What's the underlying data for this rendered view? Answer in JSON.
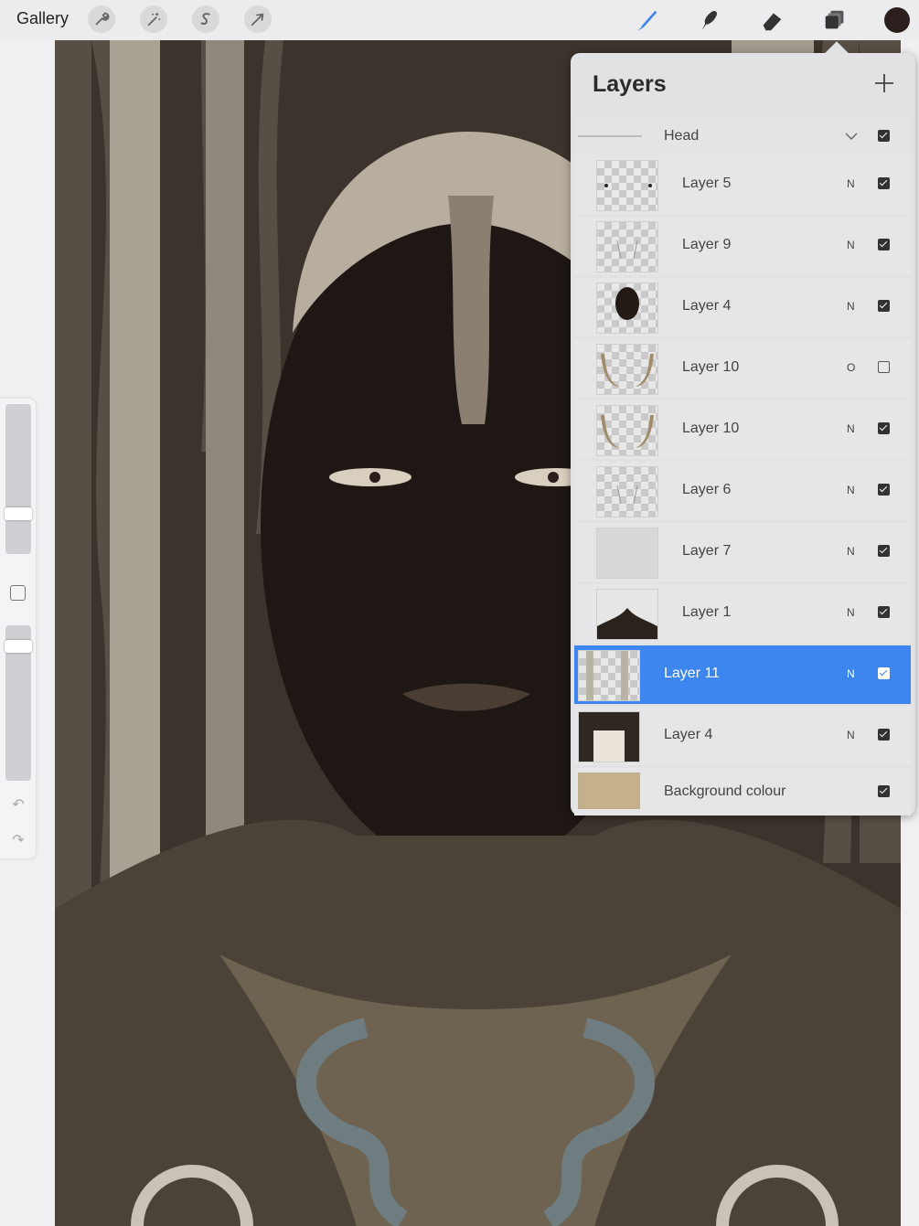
{
  "topbar": {
    "gallery_label": "Gallery",
    "left_tools": [
      "wrench-icon",
      "magic-wand-icon",
      "selection-s-icon",
      "arrow-transform-icon"
    ],
    "right_tools": [
      "brush-icon",
      "smudge-icon",
      "eraser-icon",
      "layers-icon"
    ],
    "active_color": "#2a1f1c",
    "accent": "#3d86f0"
  },
  "sidebar": {
    "brush_size_level": 0.25,
    "opacity_level": 0.9
  },
  "layers_panel": {
    "title": "Layers",
    "group": {
      "name": "Head"
    },
    "layers": [
      {
        "name": "Layer 5",
        "blend": "N",
        "visible": true,
        "selected": false,
        "thumb": "eyes"
      },
      {
        "name": "Layer 9",
        "blend": "N",
        "visible": true,
        "selected": false,
        "thumb": "lines"
      },
      {
        "name": "Layer 4",
        "blend": "N",
        "visible": true,
        "selected": false,
        "thumb": "face"
      },
      {
        "name": "Layer 10",
        "blend": "O",
        "visible": false,
        "selected": false,
        "thumb": "horns"
      },
      {
        "name": "Layer 10",
        "blend": "N",
        "visible": true,
        "selected": false,
        "thumb": "horns"
      },
      {
        "name": "Layer 6",
        "blend": "N",
        "visible": true,
        "selected": false,
        "thumb": "lines"
      },
      {
        "name": "Layer 7",
        "blend": "N",
        "visible": true,
        "selected": false,
        "thumb": "grey"
      },
      {
        "name": "Layer 1",
        "blend": "N",
        "visible": true,
        "selected": false,
        "thumb": "figure"
      },
      {
        "name": "Layer 11",
        "blend": "N",
        "visible": true,
        "selected": true,
        "thumb": "stripes"
      },
      {
        "name": "Layer 4",
        "blend": "N",
        "visible": true,
        "selected": false,
        "thumb": "dark"
      }
    ],
    "background": {
      "name": "Background colour",
      "color": "#c4b08b",
      "visible": true
    }
  }
}
